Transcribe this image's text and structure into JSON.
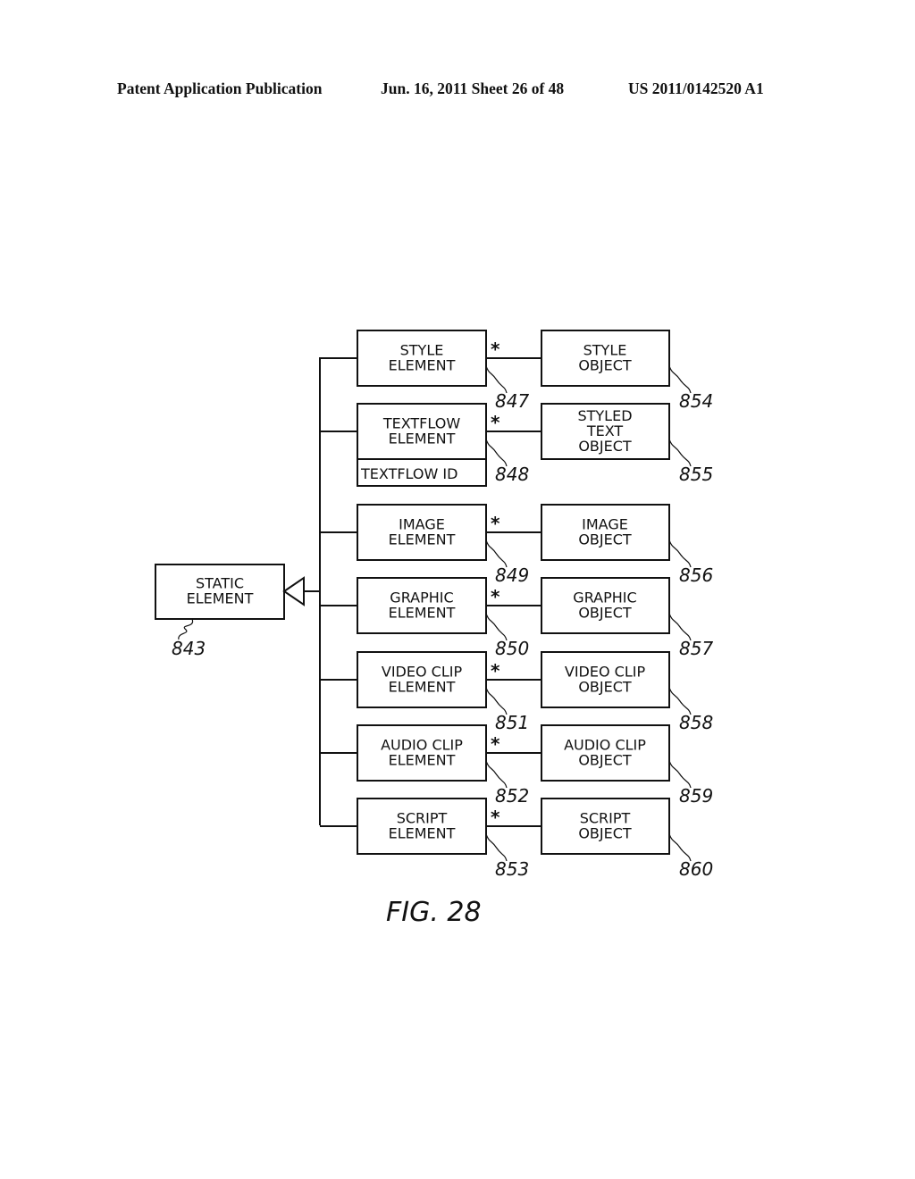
{
  "header": {
    "publication": "Patent Application Publication",
    "date_sheet": "Jun. 16, 2011  Sheet 26 of 48",
    "patent_number": "US 2011/0142520 A1"
  },
  "figure": {
    "caption": "FIG. 28",
    "root": {
      "lines": [
        "STATIC",
        "ELEMENT"
      ],
      "ref": "843"
    },
    "multiplicity": "*",
    "rows": [
      {
        "element": [
          "STYLE",
          "ELEMENT"
        ],
        "element_ref": "847",
        "object": [
          "STYLE",
          "OBJECT"
        ],
        "object_ref": "854"
      },
      {
        "element": [
          "TEXTFLOW",
          "ELEMENT"
        ],
        "element_attribute": "TEXTFLOW ID",
        "element_ref": "848",
        "object": [
          "STYLED",
          "TEXT",
          "OBJECT"
        ],
        "object_ref": "855"
      },
      {
        "element": [
          "IMAGE",
          "ELEMENT"
        ],
        "element_ref": "849",
        "object": [
          "IMAGE",
          "OBJECT"
        ],
        "object_ref": "856"
      },
      {
        "element": [
          "GRAPHIC",
          "ELEMENT"
        ],
        "element_ref": "850",
        "object": [
          "GRAPHIC",
          "OBJECT"
        ],
        "object_ref": "857"
      },
      {
        "element": [
          "VIDEO CLIP",
          "ELEMENT"
        ],
        "element_ref": "851",
        "object": [
          "VIDEO CLIP",
          "OBJECT"
        ],
        "object_ref": "858"
      },
      {
        "element": [
          "AUDIO CLIP",
          "ELEMENT"
        ],
        "element_ref": "852",
        "object": [
          "AUDIO CLIP",
          "OBJECT"
        ],
        "object_ref": "859"
      },
      {
        "element": [
          "SCRIPT",
          "ELEMENT"
        ],
        "element_ref": "853",
        "object": [
          "SCRIPT",
          "OBJECT"
        ],
        "object_ref": "860"
      }
    ]
  }
}
